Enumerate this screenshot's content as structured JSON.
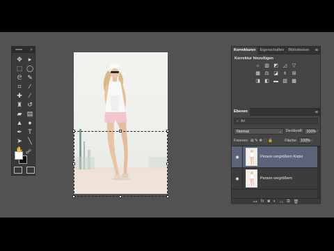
{
  "tools_panel": {
    "collapse_label": "»",
    "tools": [
      {
        "name": "move-tool-icon",
        "glyph": "✥"
      },
      {
        "name": "artboard-tool-icon",
        "glyph": "▸"
      },
      {
        "name": "rect-marquee-icon",
        "glyph": "⬚"
      },
      {
        "name": "elliptical-marquee-icon",
        "glyph": "◯"
      },
      {
        "name": "lasso-icon",
        "glyph": "ᘓ"
      },
      {
        "name": "quick-selection-icon",
        "glyph": "✎"
      },
      {
        "name": "crop-icon",
        "glyph": "⌗"
      },
      {
        "name": "eyedropper-icon",
        "glyph": "⁄"
      },
      {
        "name": "healing-brush-icon",
        "glyph": "✚"
      },
      {
        "name": "brush-icon",
        "glyph": "∕"
      },
      {
        "name": "clone-stamp-icon",
        "glyph": "♜"
      },
      {
        "name": "history-brush-icon",
        "glyph": "↺"
      },
      {
        "name": "eraser-icon",
        "glyph": "▰"
      },
      {
        "name": "gradient-icon",
        "glyph": "▤"
      },
      {
        "name": "blur-icon",
        "glyph": "▲"
      },
      {
        "name": "dodge-icon",
        "glyph": "●"
      },
      {
        "name": "pen-icon",
        "glyph": "✒"
      },
      {
        "name": "type-icon",
        "glyph": "T"
      },
      {
        "name": "path-select-icon",
        "glyph": "➤"
      },
      {
        "name": "line-icon",
        "glyph": "╲"
      },
      {
        "name": "hand-icon",
        "glyph": "✋"
      },
      {
        "name": "zoom-icon",
        "glyph": "⌕"
      },
      {
        "name": "more-tools-icon",
        "glyph": "···"
      }
    ],
    "foreground_color": "#ffffff",
    "background_color": "#111111"
  },
  "right_panel": {
    "tabs": [
      "Korrekturen",
      "Eigenschaften",
      "Bibliotheken"
    ],
    "menu_icon": "≡",
    "adjustments_title": "Korrektur hinzufügen",
    "adjustment_icons_row1": [
      "☼",
      "▥",
      "◩",
      "◿",
      "▽"
    ],
    "adjustment_icons_row2": [
      "▦",
      "⚖",
      "◪",
      "⌽",
      "⊞"
    ],
    "adjustment_icons_row3": [
      "◨",
      "◧",
      "▬",
      "▧",
      "▩"
    ]
  },
  "layers_panel": {
    "tab": "Ebenen",
    "filter_label": "Art",
    "blend_mode": "Normal",
    "opacity_label": "Deckkraft:",
    "opacity_value": "100%",
    "lock_label": "Fixieren:",
    "lock_icons": "⊠ ✎ ✥ ⬚ 🔒",
    "fill_label": "Fläche:",
    "fill_value": "100%",
    "layers": [
      {
        "name": "Person vergrößern Kopie",
        "visible": true,
        "selected": true
      },
      {
        "name": "Person vergrößern",
        "visible": true,
        "selected": false
      }
    ],
    "footer_icons": [
      "⊶",
      "fx",
      "◙",
      "◐",
      "▭",
      "⧉",
      "🗑"
    ]
  }
}
